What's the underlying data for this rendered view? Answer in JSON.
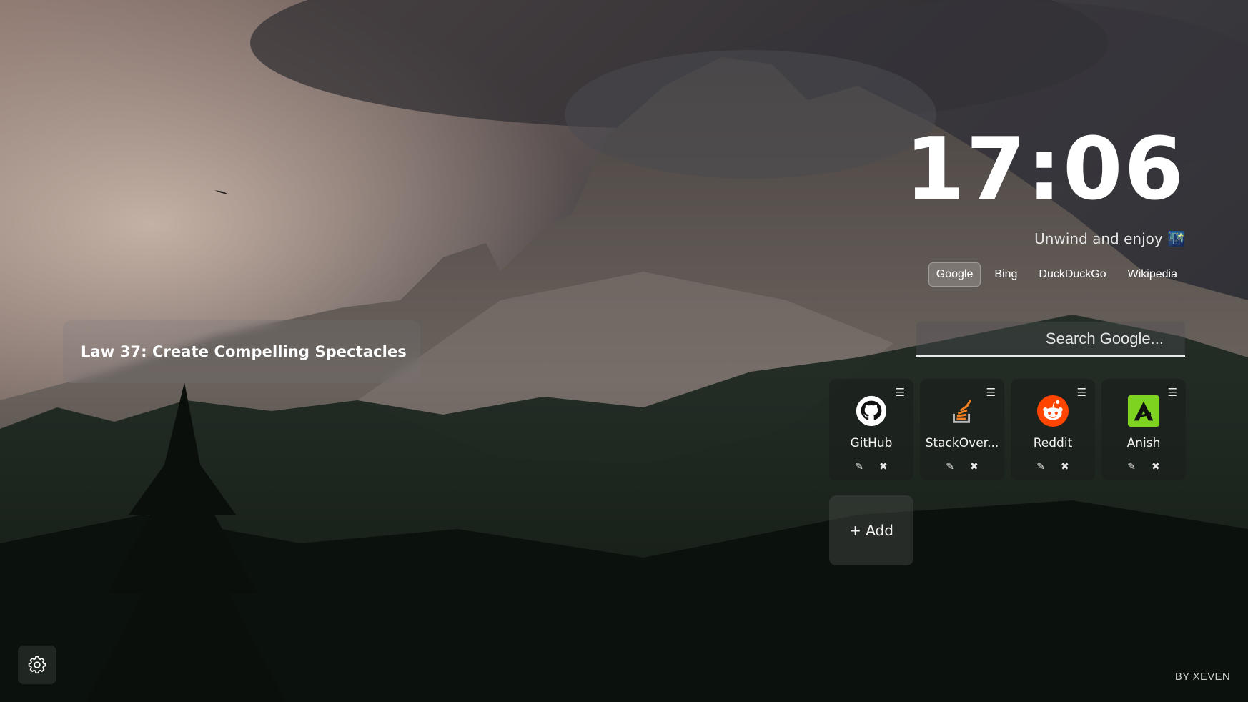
{
  "quote": {
    "text": "Law 37: Create Compelling Spectacles"
  },
  "clock": {
    "time": "17:06"
  },
  "greeting": {
    "text": "Unwind and enjoy",
    "emoji": "🌃"
  },
  "search_engines": [
    {
      "label": "Google",
      "active": true
    },
    {
      "label": "Bing",
      "active": false
    },
    {
      "label": "DuckDuckGo",
      "active": false
    },
    {
      "label": "Wikipedia",
      "active": false
    }
  ],
  "search": {
    "placeholder": "Search Google..."
  },
  "shortcuts": [
    {
      "name": "GitHub",
      "icon": "github-icon"
    },
    {
      "name": "StackOver...",
      "icon": "stackoverflow-icon"
    },
    {
      "name": "Reddit",
      "icon": "reddit-icon"
    },
    {
      "name": "Anish",
      "icon": "anish-icon"
    }
  ],
  "tile_controls": {
    "menu": "☰",
    "edit": "✎",
    "delete": "✖"
  },
  "add_label": "+ Add",
  "footer": {
    "credit": "BY XEVEN"
  },
  "colors": {
    "reddit": "#ff4500",
    "stackoverflow": "#f48024",
    "anish": "#7ed321"
  }
}
